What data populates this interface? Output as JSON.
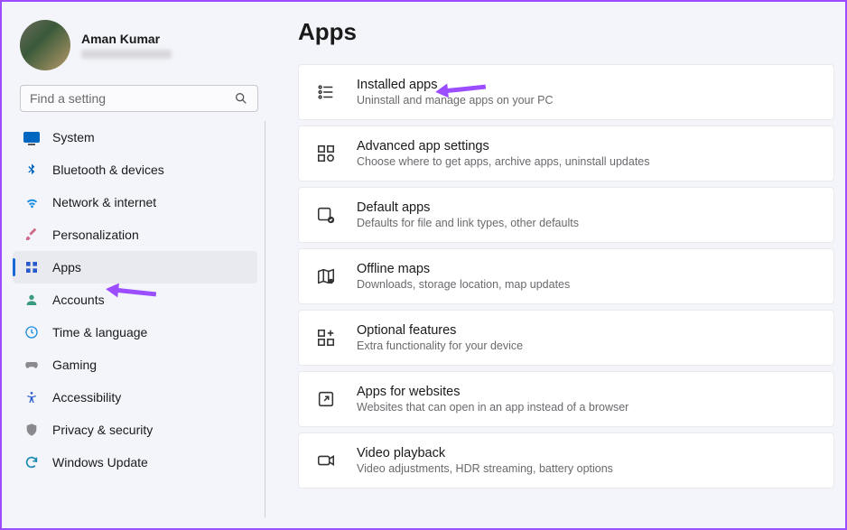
{
  "profile": {
    "name": "Aman Kumar"
  },
  "search": {
    "placeholder": "Find a setting"
  },
  "nav": {
    "items": [
      {
        "label": "System"
      },
      {
        "label": "Bluetooth & devices"
      },
      {
        "label": "Network & internet"
      },
      {
        "label": "Personalization"
      },
      {
        "label": "Apps"
      },
      {
        "label": "Accounts"
      },
      {
        "label": "Time & language"
      },
      {
        "label": "Gaming"
      },
      {
        "label": "Accessibility"
      },
      {
        "label": "Privacy & security"
      },
      {
        "label": "Windows Update"
      }
    ]
  },
  "page": {
    "title": "Apps"
  },
  "cards": [
    {
      "title": "Installed apps",
      "sub": "Uninstall and manage apps on your PC"
    },
    {
      "title": "Advanced app settings",
      "sub": "Choose where to get apps, archive apps, uninstall updates"
    },
    {
      "title": "Default apps",
      "sub": "Defaults for file and link types, other defaults"
    },
    {
      "title": "Offline maps",
      "sub": "Downloads, storage location, map updates"
    },
    {
      "title": "Optional features",
      "sub": "Extra functionality for your device"
    },
    {
      "title": "Apps for websites",
      "sub": "Websites that can open in an app instead of a browser"
    },
    {
      "title": "Video playback",
      "sub": "Video adjustments, HDR streaming, battery options"
    }
  ],
  "annotations": {
    "arrow_color": "#9b4dff"
  }
}
